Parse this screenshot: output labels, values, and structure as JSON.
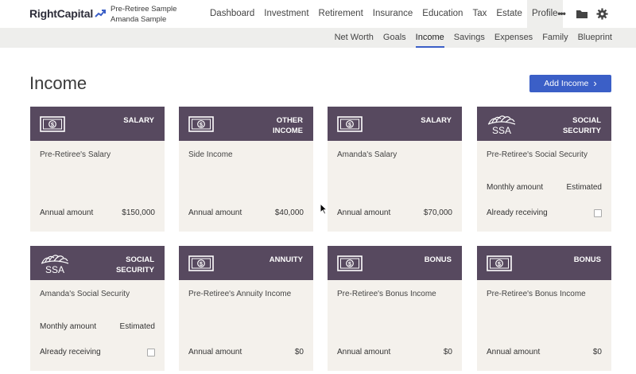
{
  "brand": {
    "name": "RightCapital"
  },
  "household": {
    "line1": "Pre-Retiree Sample",
    "line2": "Amanda Sample"
  },
  "main_nav": [
    "Dashboard",
    "Investment",
    "Retirement",
    "Insurance",
    "Education",
    "Tax",
    "Estate",
    "Profile"
  ],
  "main_nav_active": "Profile",
  "more_label": "•••",
  "sub_nav": [
    "Net Worth",
    "Goals",
    "Income",
    "Savings",
    "Expenses",
    "Family",
    "Blueprint"
  ],
  "sub_nav_active": "Income",
  "page": {
    "title": "Income",
    "add_button": "Add Income",
    "add_button_chevron": "›"
  },
  "colors": {
    "card_header": "#57495f",
    "card_body": "#f4f1ec",
    "accent": "#3b5fc7",
    "subbar": "#eeeeec"
  },
  "cards": [
    {
      "icon": "cash-icon",
      "type": "SALARY",
      "name": "Pre-Retiree's Salary",
      "rows": [
        {
          "label": "Annual amount",
          "value": "$150,000"
        }
      ]
    },
    {
      "icon": "cash-icon",
      "type": "OTHER\nINCOME",
      "name": "Side Income",
      "rows": [
        {
          "label": "Annual amount",
          "value": "$40,000"
        }
      ]
    },
    {
      "icon": "cash-icon",
      "type": "SALARY",
      "name": "Amanda's Salary",
      "rows": [
        {
          "label": "Annual amount",
          "value": "$70,000"
        }
      ]
    },
    {
      "icon": "ssa-icon",
      "type": "SOCIAL\nSECURITY",
      "name": "Pre-Retiree's Social Security",
      "rows": [
        {
          "label": "Monthly amount",
          "value": "Estimated"
        },
        {
          "label": "Already receiving",
          "checkbox": true
        }
      ]
    },
    {
      "icon": "ssa-icon",
      "type": "SOCIAL\nSECURITY",
      "name": "Amanda's Social Security",
      "rows": [
        {
          "label": "Monthly amount",
          "value": "Estimated"
        },
        {
          "label": "Already receiving",
          "checkbox": true
        }
      ]
    },
    {
      "icon": "cash-icon",
      "type": "ANNUITY",
      "name": "Pre-Retiree's Annuity Income",
      "rows": [
        {
          "label": "Annual amount",
          "value": "$0"
        }
      ]
    },
    {
      "icon": "cash-icon",
      "type": "BONUS",
      "name": "Pre-Retiree's Bonus Income",
      "rows": [
        {
          "label": "Annual amount",
          "value": "$0"
        }
      ]
    },
    {
      "icon": "cash-icon",
      "type": "BONUS",
      "name": "Pre-Retiree's Bonus Income",
      "rows": [
        {
          "label": "Annual amount",
          "value": "$0"
        }
      ]
    }
  ]
}
